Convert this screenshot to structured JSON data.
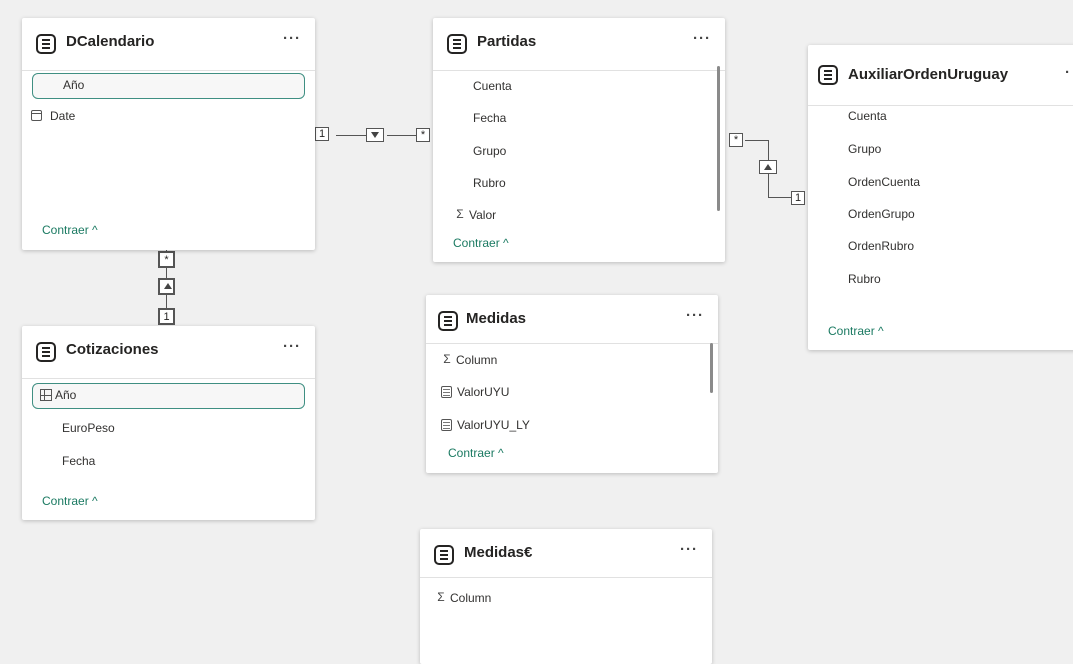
{
  "tables": {
    "dcalendario": {
      "title": "DCalendario",
      "more": "···",
      "fields": [
        "Año",
        "Date"
      ],
      "collapse": "Contraer ^"
    },
    "partidas": {
      "title": "Partidas",
      "more": "···",
      "fields": [
        "Cuenta",
        "Fecha",
        "Grupo",
        "Rubro",
        "Valor"
      ],
      "collapse": "Contraer ^"
    },
    "auxiliar": {
      "title": "AuxiliarOrdenUruguay",
      "more": "·",
      "fields": [
        "Cuenta",
        "Grupo",
        "OrdenCuenta",
        "OrdenGrupo",
        "OrdenRubro",
        "Rubro"
      ],
      "collapse": "Contraer ^"
    },
    "cotizaciones": {
      "title": "Cotizaciones",
      "more": "···",
      "fields": [
        "Año",
        "EuroPeso",
        "Fecha"
      ],
      "collapse": "Contraer ^"
    },
    "medidas": {
      "title": "Medidas",
      "more": "···",
      "fields": [
        "Column",
        "ValorUYU",
        "ValorUYU_LY"
      ],
      "collapse": "Contraer ^"
    },
    "medidas_eur": {
      "title": "Medidas€",
      "more": "···",
      "fields": [
        "Column"
      ]
    }
  },
  "relationships": {
    "one": "1",
    "many": "*"
  },
  "icons": {
    "table": "table-icon",
    "sum": "Σ",
    "date": "calendar-icon",
    "measure": "calculator-icon",
    "hierarchy": "hierarchy-icon"
  },
  "colors": {
    "selected_border": "#3f8f82",
    "link": "#1b7a62",
    "canvas": "#f0f0f0"
  }
}
